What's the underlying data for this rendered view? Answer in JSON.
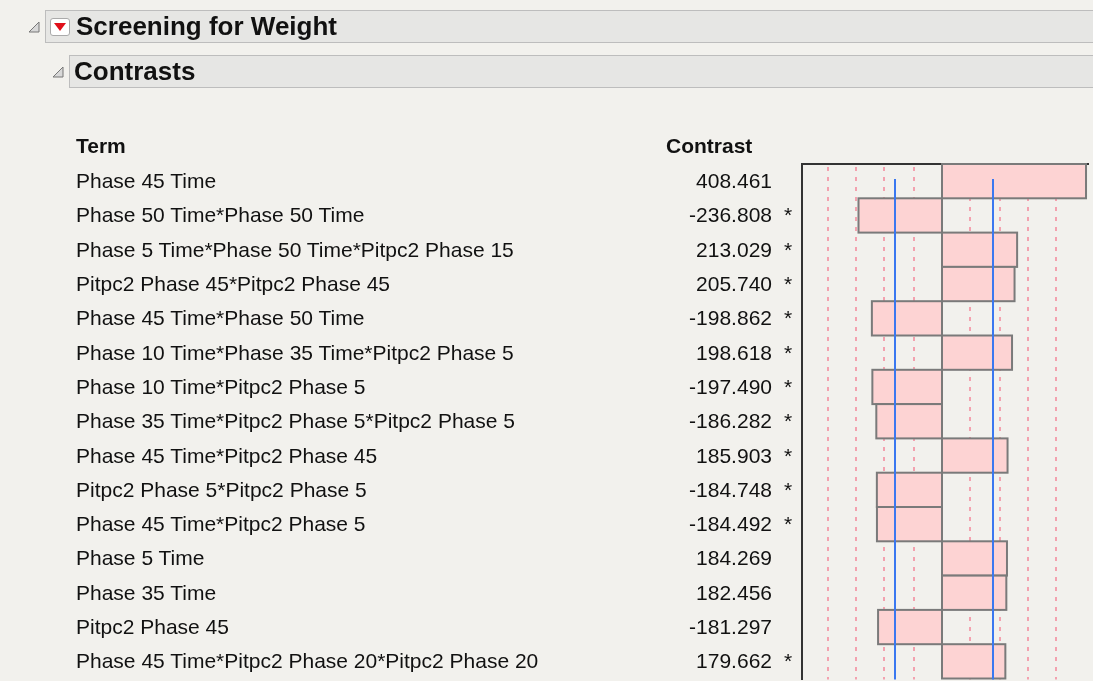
{
  "report": {
    "title": "Screening for Weight"
  },
  "section": {
    "title": "Contrasts"
  },
  "table": {
    "columns": [
      "Term",
      "Contrast"
    ],
    "rows": [
      {
        "term": "Phase 45 Time",
        "contrast": "408.461"
      },
      {
        "term": "Phase 50 Time*Phase 50 Time",
        "contrast": "-236.808",
        "mark": "*"
      },
      {
        "term": "Phase 5 Time*Phase 50 Time*Pitpc2 Phase 15",
        "contrast": "213.029",
        "mark": "*"
      },
      {
        "term": "Pitpc2 Phase 45*Pitpc2 Phase 45",
        "contrast": "205.740",
        "mark": "*"
      },
      {
        "term": "Phase 45 Time*Phase 50 Time",
        "contrast": "-198.862",
        "mark": "*"
      },
      {
        "term": "Phase 10 Time*Phase 35 Time*Pitpc2 Phase 5",
        "contrast": "198.618",
        "mark": "*"
      },
      {
        "term": "Phase 10 Time*Pitpc2 Phase 5",
        "contrast": "-197.490",
        "mark": "*"
      },
      {
        "term": "Phase 35 Time*Pitpc2 Phase 5*Pitpc2 Phase 5",
        "contrast": "-186.282",
        "mark": "*"
      },
      {
        "term": "Phase 45 Time*Pitpc2 Phase 45",
        "contrast": "185.903",
        "mark": "*"
      },
      {
        "term": "Pitpc2 Phase 5*Pitpc2 Phase 5",
        "contrast": "-184.748",
        "mark": "*"
      },
      {
        "term": "Phase 45 Time*Pitpc2 Phase 5",
        "contrast": "-184.492",
        "mark": "*"
      },
      {
        "term": "Phase 5 Time",
        "contrast": "184.269"
      },
      {
        "term": "Phase 35 Time",
        "contrast": "182.456"
      },
      {
        "term": "Pitpc2 Phase 45",
        "contrast": "-181.297"
      },
      {
        "term": "Phase 45 Time*Pitpc2 Phase 20*Pitpc2 Phase 20",
        "contrast": "179.662",
        "mark": "*"
      }
    ]
  }
}
